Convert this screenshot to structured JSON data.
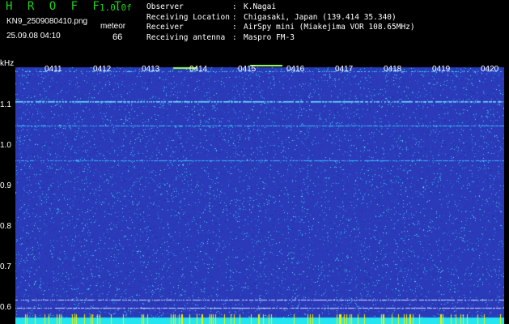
{
  "header": {
    "app_title": "H R O F F T",
    "version": "1.0.0f",
    "filename": "KN9_2509080410.png",
    "timestamp": "25.09.08 04:10",
    "meteor_label": "meteor",
    "meteor_count": "66"
  },
  "info": [
    {
      "key": "Observer",
      "value": "K.Nagai"
    },
    {
      "key": "Receiving Location",
      "value": "Chigasaki, Japan (139.414 35.340)"
    },
    {
      "key": "Receiver",
      "value": "AirSpy mini (Miakejima VOR 108.65MHz)"
    },
    {
      "key": "Receiving antenna",
      "value": "Maspro FM-3"
    }
  ],
  "spectrogram": {
    "y_unit": "kHz",
    "y_ticks": [
      "1.1",
      "1.0",
      "0.9",
      "0.8",
      "0.7",
      "0.6"
    ],
    "time_ticks": [
      "0411",
      "0412",
      "0413",
      "0414",
      "0415",
      "0416",
      "0417",
      "0418",
      "0419",
      "0420"
    ],
    "colors": {
      "background": "#2a3ab8",
      "noise": "#37c3ff",
      "baseline": "#24e6f0",
      "marker": "#f0f000"
    }
  }
}
